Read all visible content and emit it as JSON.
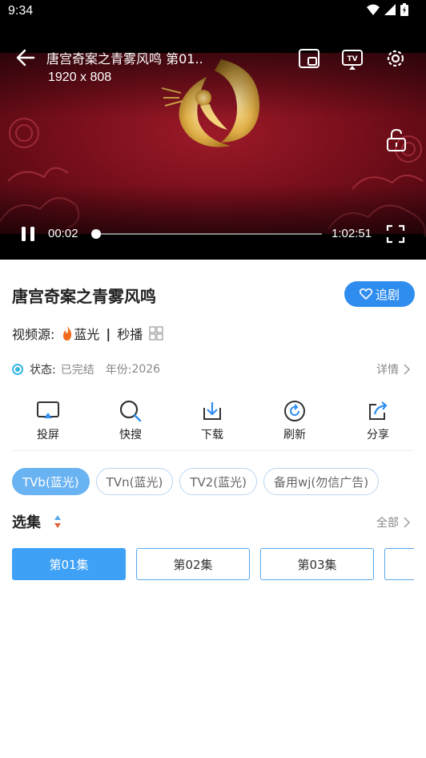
{
  "status_bar": {
    "time": "9:34"
  },
  "player": {
    "title": "唐宫奇案之青雾风鸣 第01..",
    "resolution": "1920 x 808",
    "current_time": "00:02",
    "total_time": "1:02:51",
    "progress": 0.0005,
    "icons": [
      "back-arrow-icon",
      "pip-icon",
      "tv-cast-icon",
      "settings-gear-icon",
      "unlock-icon",
      "pause-icon",
      "fullscreen-icon"
    ]
  },
  "show": {
    "title": "唐宫奇案之青雾风鸣",
    "follow_label": "追剧"
  },
  "source": {
    "label": "视频源:",
    "quality": "蓝光",
    "speed": "秒播"
  },
  "meta": {
    "status_label": "状态:",
    "status_value": "已完结",
    "year_label": "年份:",
    "year_value": "2026",
    "detail_label": "详情"
  },
  "actions": [
    {
      "label": "投屏",
      "icon": "cast-screen-icon"
    },
    {
      "label": "快搜",
      "icon": "search-icon"
    },
    {
      "label": "下载",
      "icon": "download-icon"
    },
    {
      "label": "刷新",
      "icon": "refresh-icon"
    },
    {
      "label": "分享",
      "icon": "share-icon"
    }
  ],
  "lines": [
    {
      "label": "TVb(蓝光)",
      "active": true
    },
    {
      "label": "TVn(蓝光)",
      "active": false
    },
    {
      "label": "TV2(蓝光)",
      "active": false
    },
    {
      "label": "备用wj(勿信广告)",
      "active": false
    }
  ],
  "episodes_section": {
    "title": "选集",
    "all_label": "全部",
    "items": [
      {
        "label": "第01集",
        "active": true
      },
      {
        "label": "第02集",
        "active": false
      },
      {
        "label": "第03集",
        "active": false
      }
    ]
  },
  "colors": {
    "accent": "#2f8df0",
    "active_tab": "#6ab3f2",
    "video_bg": "#7a0f1c"
  }
}
